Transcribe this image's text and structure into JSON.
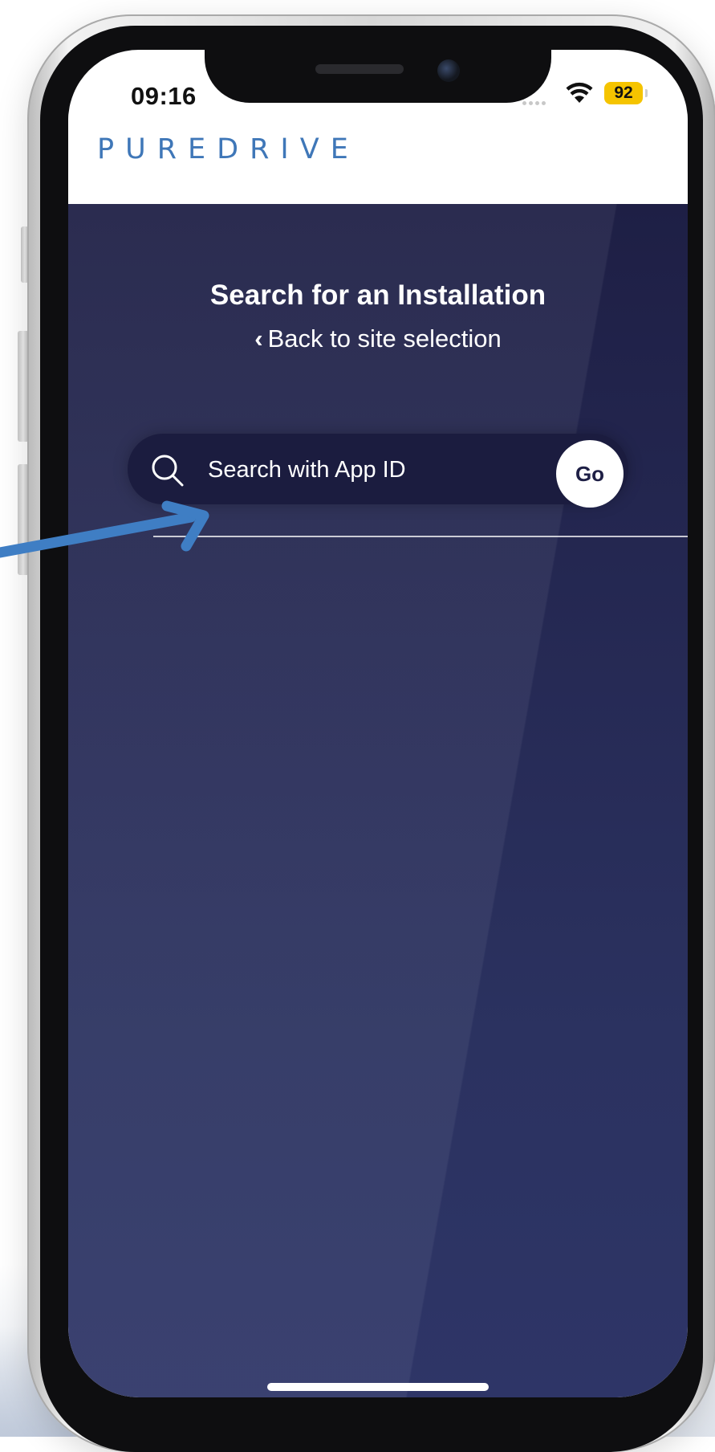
{
  "status_bar": {
    "time": "09:16",
    "battery_percent": "92",
    "battery_color": "#f5c400",
    "icons": [
      "cellular-dots-icon",
      "wifi-icon",
      "battery-icon"
    ]
  },
  "header": {
    "brand": "PUREDRIVE",
    "brand_color": "#3f77b8"
  },
  "main": {
    "title": "Search for an Installation",
    "back_link_label": "Back to site selection",
    "back_icon": "chevron-left-icon",
    "search": {
      "icon": "search-icon",
      "placeholder": "Search with App ID",
      "value": "",
      "go_label": "Go"
    },
    "background_color": "#262a55"
  },
  "annotation": {
    "icon": "pointer-arrow-icon",
    "color": "#3f7ec4"
  }
}
